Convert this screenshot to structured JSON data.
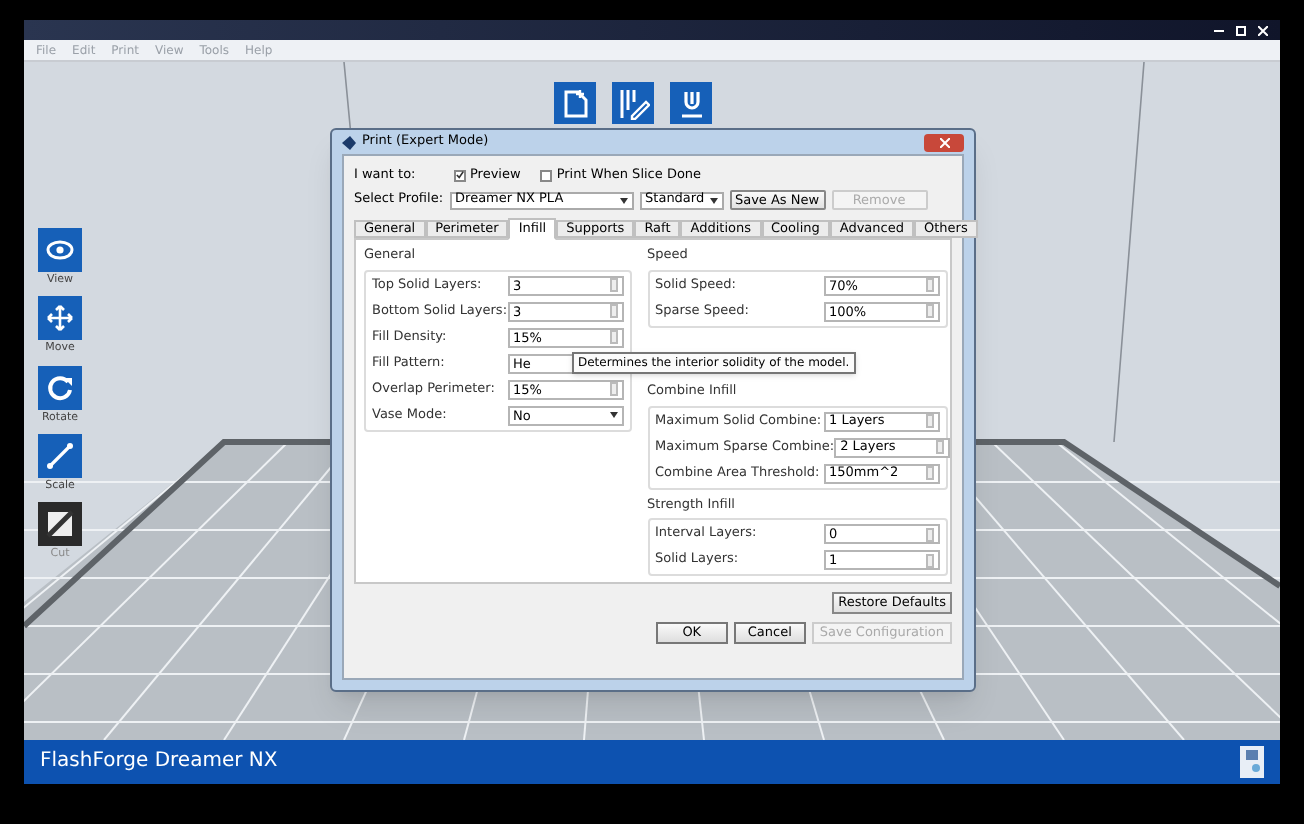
{
  "menu": [
    "File",
    "Edit",
    "Print",
    "View",
    "Tools",
    "Help"
  ],
  "top_tools": [
    {
      "kind": "load"
    },
    {
      "kind": "supports"
    },
    {
      "kind": "print"
    }
  ],
  "tools": [
    {
      "label": "View",
      "kind": "view",
      "disabled": false
    },
    {
      "label": "Move",
      "kind": "move",
      "disabled": false
    },
    {
      "label": "Rotate",
      "kind": "rotate",
      "disabled": false
    },
    {
      "label": "Scale",
      "kind": "scale",
      "disabled": false
    },
    {
      "label": "Cut",
      "kind": "cut",
      "disabled": true
    }
  ],
  "dialog": {
    "title": "Print (Expert Mode)",
    "want_label": "I want to:",
    "options": [
      {
        "label": "Preview",
        "checked": true
      },
      {
        "label": "Print When Slice Done",
        "checked": false
      }
    ],
    "profile_label": "Select Profile:",
    "profile": "Dreamer NX PLA",
    "quality": "Standard",
    "profile_buttons": [
      {
        "label": "Save As New",
        "disabled": false
      },
      {
        "label": "Remove",
        "disabled": true
      }
    ],
    "tabs": [
      {
        "label": "General",
        "selected": false
      },
      {
        "label": "Perimeter",
        "selected": false
      },
      {
        "label": "Infill",
        "selected": true
      },
      {
        "label": "Supports",
        "selected": false
      },
      {
        "label": "Raft",
        "selected": false
      },
      {
        "label": "Additions",
        "selected": false
      },
      {
        "label": "Cooling",
        "selected": false
      },
      {
        "label": "Advanced",
        "selected": false
      },
      {
        "label": "Others",
        "selected": false
      }
    ],
    "left_groups": [
      {
        "title": "General",
        "rows": [
          {
            "label": "Top Solid Layers:",
            "value": "3",
            "kind": "spin"
          },
          {
            "label": "Bottom Solid Layers:",
            "value": "3",
            "kind": "spin"
          },
          {
            "label": "Fill Density:",
            "value": "15%",
            "kind": "spin"
          },
          {
            "label": "Fill Pattern:",
            "value": "He",
            "kind": "combo"
          },
          {
            "label": "Overlap Perimeter:",
            "value": "15%",
            "kind": "spin"
          },
          {
            "label": "Vase Mode:",
            "value": "No",
            "kind": "combo"
          }
        ]
      }
    ],
    "right_groups": [
      {
        "title": "Speed",
        "rows": [
          {
            "label": "Solid Speed:",
            "value": "70%",
            "kind": "spin"
          },
          {
            "label": "Sparse Speed:",
            "value": "100%",
            "kind": "spin"
          }
        ]
      },
      {
        "title": "Combine Infill",
        "rows": [
          {
            "label": "Maximum Solid Combine:",
            "value": "1 Layers",
            "kind": "spin"
          },
          {
            "label": "Maximum Sparse Combine:",
            "value": "2 Layers",
            "kind": "spin"
          },
          {
            "label": "Combine Area Threshold:",
            "value": "150mm^2",
            "kind": "spin"
          }
        ]
      },
      {
        "title": "Strength Infill",
        "rows": [
          {
            "label": "Interval Layers:",
            "value": "0",
            "kind": "spin"
          },
          {
            "label": "Solid Layers:",
            "value": "1",
            "kind": "spin"
          }
        ]
      }
    ],
    "tooltip": "Determines the interior solidity of the model.",
    "restore": "Restore Defaults",
    "buttons": [
      {
        "label": "OK",
        "disabled": false
      },
      {
        "label": "Cancel",
        "disabled": false
      },
      {
        "label": "Save Configuration",
        "disabled": true
      }
    ]
  },
  "status_bar": {
    "printer": "FlashForge Dreamer NX"
  }
}
